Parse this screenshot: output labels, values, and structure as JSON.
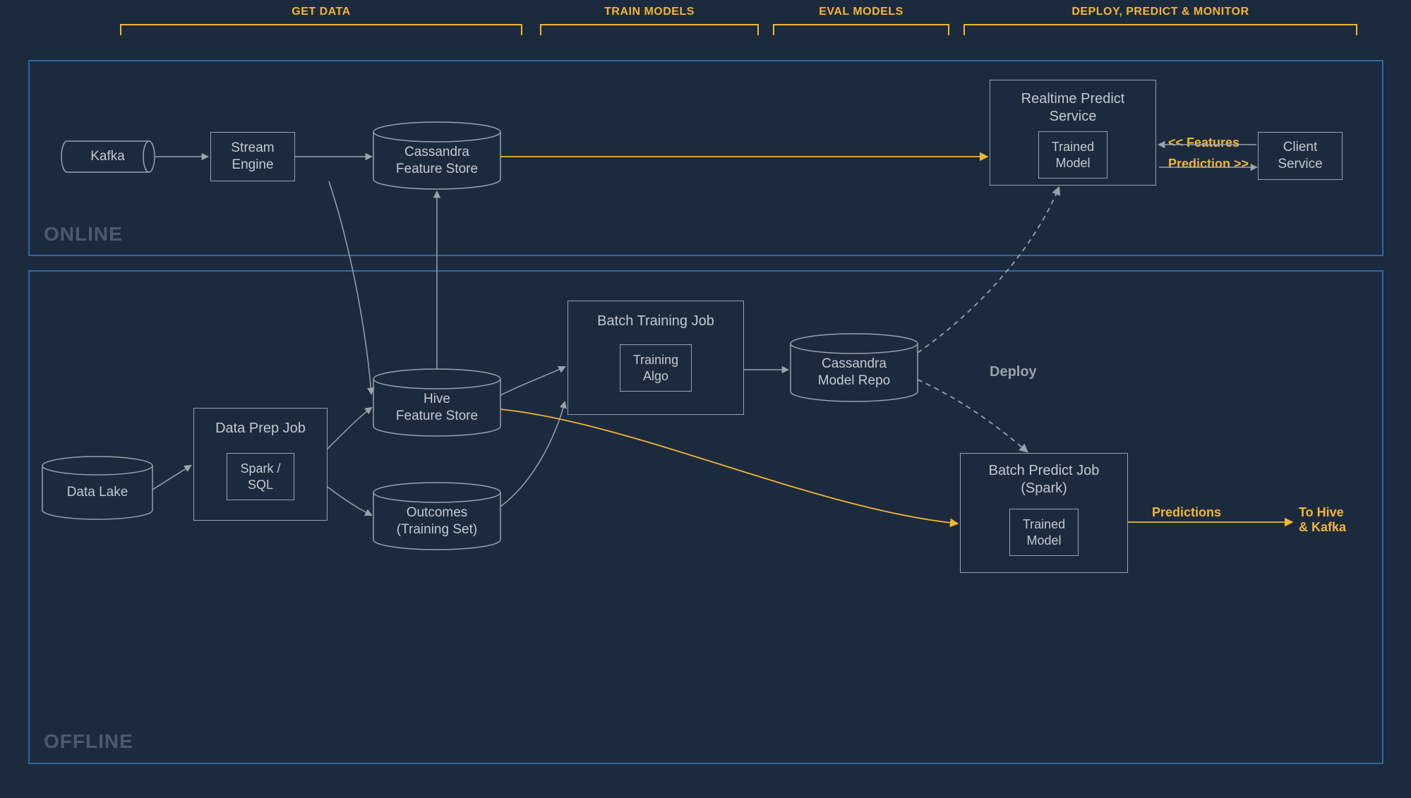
{
  "stages": {
    "get_data": "GET DATA",
    "train_models": "TRAIN MODELS",
    "eval_models": "EVAL MODELS",
    "deploy_predict_monitor": "DEPLOY, PREDICT & MONITOR"
  },
  "zones": {
    "online": "ONLINE",
    "offline": "OFFLINE"
  },
  "nodes": {
    "kafka": "Kafka",
    "stream_engine": "Stream\nEngine",
    "cassandra_feature_store": "Cassandra\nFeature Store",
    "realtime_predict_service": {
      "title": "Realtime Predict\nService",
      "inner": "Trained\nModel"
    },
    "client_service": "Client\nService",
    "data_lake": "Data Lake",
    "data_prep_job": {
      "title": "Data Prep Job",
      "inner": "Spark /\nSQL"
    },
    "hive_feature_store": "Hive\nFeature Store",
    "outcomes": "Outcomes\n(Training Set)",
    "batch_training_job": {
      "title": "Batch Training Job",
      "inner": "Training\nAlgo"
    },
    "cassandra_model_repo": "Cassandra\nModel Repo",
    "batch_predict_job": {
      "title": "Batch Predict Job\n(Spark)",
      "inner": "Trained\nModel"
    }
  },
  "labels": {
    "features_in": "<< Features",
    "prediction_out": "Prediction >>",
    "deploy": "Deploy",
    "predictions": "Predictions",
    "to_hive_kafka": "To Hive\n& Kafka"
  }
}
